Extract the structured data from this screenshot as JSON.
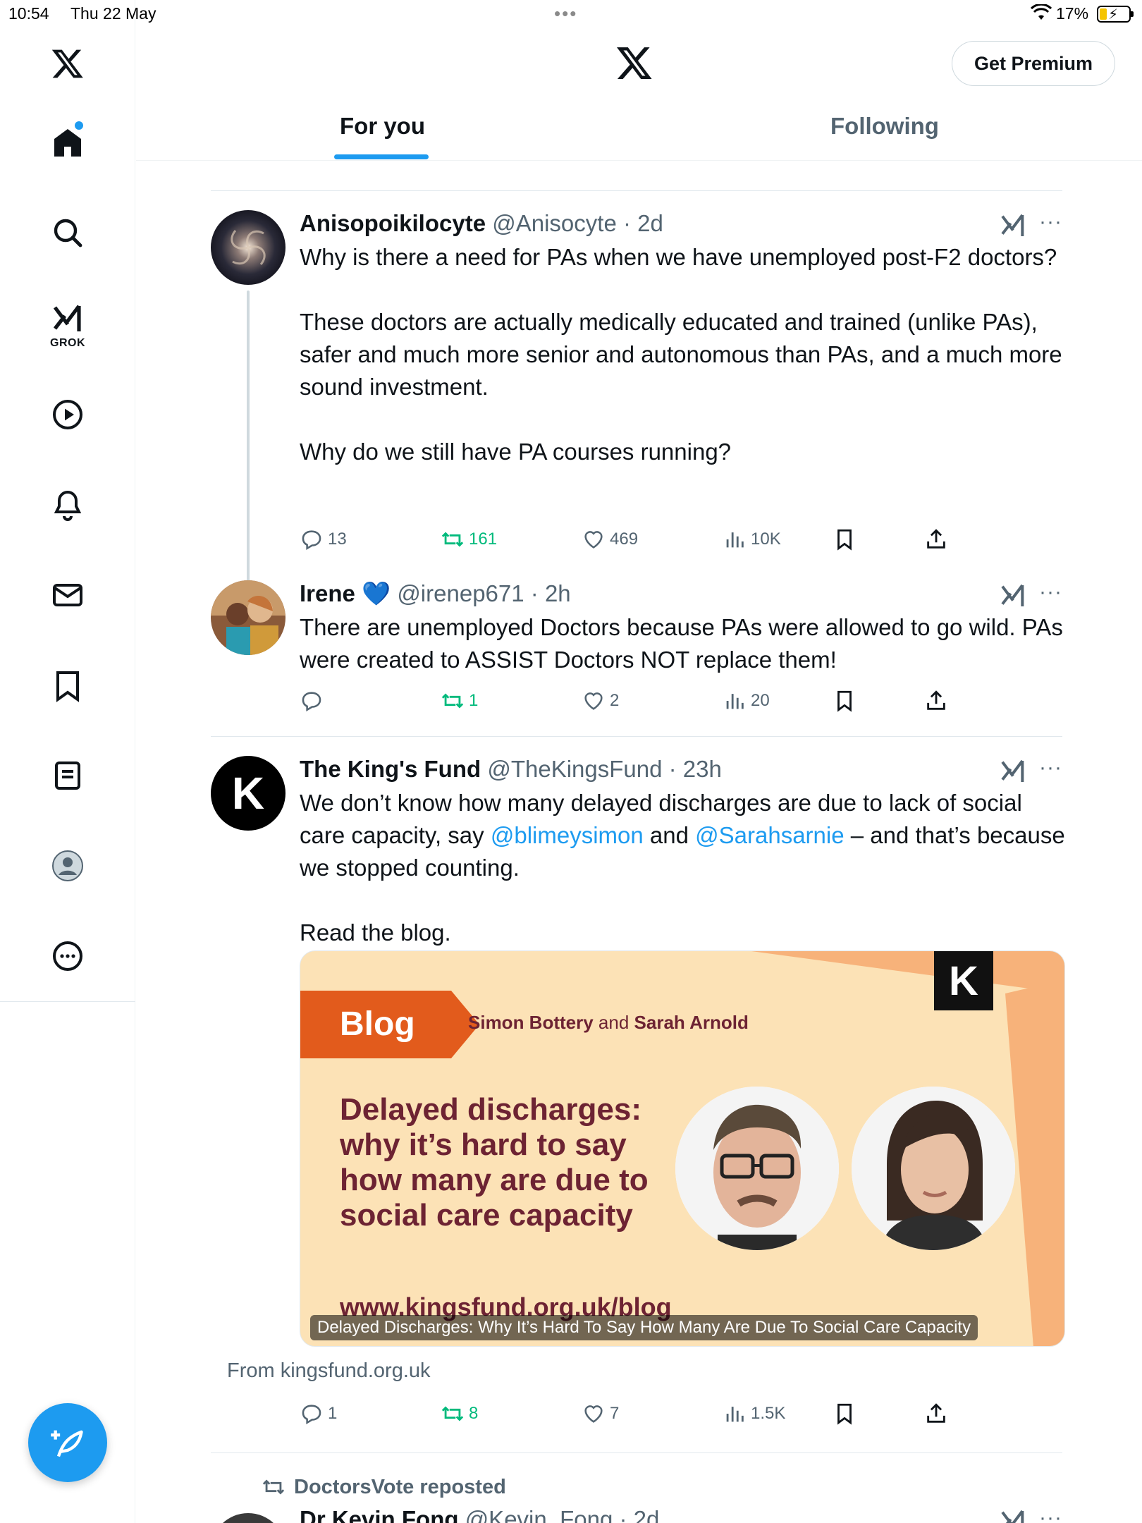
{
  "status_bar": {
    "time": "10:54",
    "date": "Thu 22 May",
    "battery": "17%"
  },
  "header": {
    "get_premium": "Get Premium",
    "tabs": [
      {
        "label": "For you",
        "active": true
      },
      {
        "label": "Following",
        "active": false
      }
    ]
  },
  "nav": {
    "grok_label": "GROK"
  },
  "tweets": [
    {
      "name": "Anisopoikilocyte",
      "handle": "@Anisocyte",
      "time": "2d",
      "text": "Why is there a need for PAs when we have unemployed post-F2 doctors?\n\nThese doctors are actually medically educated and trained (unlike PAs), safer and much more senior and autonomous than PAs, and a much more sound investment.\n\nWhy do we still have PA courses running?",
      "replies": "13",
      "reposts": "161",
      "likes": "469",
      "views": "10K"
    },
    {
      "name": "Irene",
      "badge": "💙",
      "handle": "@irenep671",
      "time": "2h",
      "text": "There are unemployed Doctors because PAs were allowed to go wild. PAs were created to ASSIST Doctors NOT replace them!",
      "replies": "",
      "reposts": "1",
      "likes": "2",
      "views": "20"
    },
    {
      "name": "The King's Fund",
      "handle": "@TheKingsFund",
      "time": "23h",
      "text_part1": "We don’t know how many delayed discharges are due to lack of social care capacity, say ",
      "mention1": "@blimeysimon",
      "text_part2": " and ",
      "mention2": "@Sarahsarnie",
      "text_part3": " – and that’s because we stopped counting.\n\nRead the blog.",
      "card": {
        "tag": "Blog",
        "author1": "Simon Bottery",
        "and": "and",
        "author2": "Sarah Arnold",
        "headline": "Delayed discharges: why it’s hard to say how many are due to social care capacity",
        "url": "www.kingsfund.org.uk/blog",
        "overlay_title": "Delayed Discharges: Why It’s Hard To Say How Many Are Due To Social Care Capacity",
        "logo_letter": "K",
        "from": "From kingsfund.org.uk"
      },
      "replies": "1",
      "reposts": "8",
      "likes": "7",
      "views": "1.5K"
    }
  ],
  "next": {
    "reposted_by": "DoctorsVote reposted",
    "name": "Dr Kevin Fong",
    "handle": "@Kevin_Fong",
    "time": "2d"
  },
  "colors": {
    "accent": "#1d9bf0",
    "repost_green": "#00ba7c",
    "muted": "#536471",
    "card_bg": "#fce2b6",
    "card_text": "#6d2333",
    "blog_tag": "#e25b1c"
  },
  "icons": [
    "x-logo-icon",
    "home-icon",
    "search-icon",
    "grok-icon",
    "video-icon",
    "bell-icon",
    "mail-icon",
    "bookmark-icon",
    "list-icon",
    "profile-icon",
    "more-icon",
    "compose-icon",
    "reply-icon",
    "repost-icon",
    "like-icon",
    "views-icon",
    "share-icon"
  ]
}
